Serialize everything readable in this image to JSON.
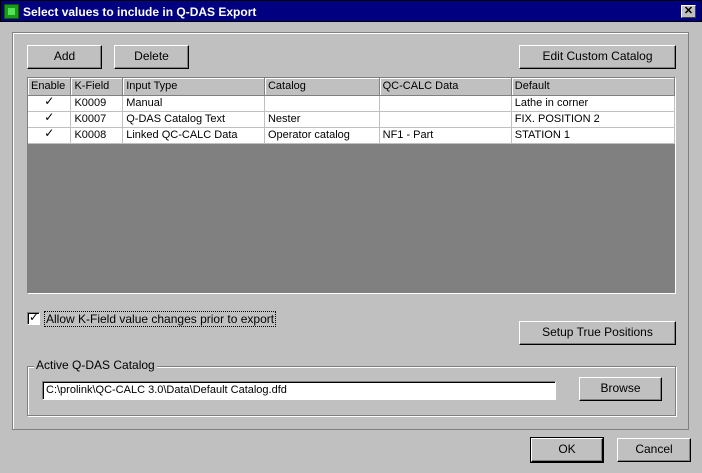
{
  "window": {
    "title": "Select values to include in Q-DAS Export",
    "close_symbol": "✕"
  },
  "toolbar": {
    "add_label": "Add",
    "delete_label": "Delete",
    "edit_catalog_label": "Edit Custom Catalog"
  },
  "grid": {
    "columns": [
      "Enable",
      "K-Field",
      "Input Type",
      "Catalog",
      "QC-CALC Data",
      "Default"
    ],
    "rows": [
      {
        "enabled": true,
        "kfield": "K0009",
        "input_type": "Manual",
        "catalog": "",
        "qc_data": "",
        "default": "Lathe in  corner"
      },
      {
        "enabled": true,
        "kfield": "K0007",
        "input_type": "Q-DAS Catalog Text",
        "catalog": "Nester",
        "qc_data": "",
        "default": "FIX. POSITION 2"
      },
      {
        "enabled": true,
        "kfield": "K0008",
        "input_type": "Linked QC-CALC Data",
        "catalog": "Operator catalog",
        "qc_data": "NF1 - Part",
        "default": "STATION 1"
      }
    ]
  },
  "allow_changes": {
    "checked": true,
    "label": "Allow K-Field value changes prior to export"
  },
  "setup_true_positions_label": "Setup True Positions",
  "catalog_group": {
    "legend": "Active Q-DAS Catalog",
    "path": "C:\\prolink\\QC-CALC 3.0\\Data\\Default Catalog.dfd",
    "browse_label": "Browse"
  },
  "footer": {
    "ok_label": "OK",
    "cancel_label": "Cancel"
  },
  "colors": {
    "titlebar": "#000080",
    "face": "#c0c0c0",
    "grid_empty": "#808080"
  }
}
